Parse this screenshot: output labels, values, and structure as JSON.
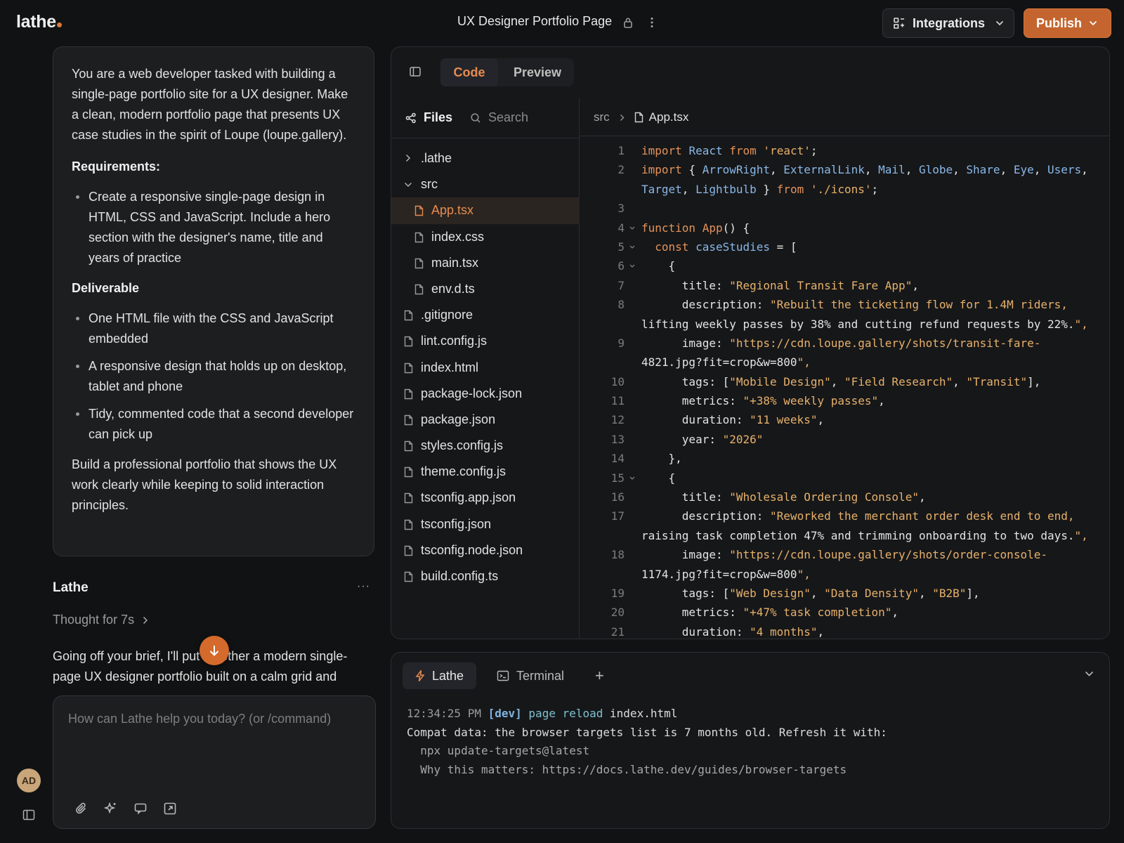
{
  "app": {
    "logo": "lathe"
  },
  "topbar": {
    "doc_title": "UX Designer Portfolio Page",
    "integrations_label": "Integrations",
    "publish_label": "Publish"
  },
  "user": {
    "initials": "AD"
  },
  "prompt": {
    "intro": "You are a web developer tasked with building a single-page portfolio site for a UX designer. Make a clean, modern portfolio page that presents UX case studies in the spirit of Loupe (loupe.gallery).",
    "requirements_heading": "Requirements:",
    "requirements": [
      "Create a responsive single-page design in HTML, CSS and JavaScript. Include a hero section with the designer's name, title and years of practice"
    ],
    "deliverable_heading": "Deliverable",
    "deliverables": [
      "One HTML file with the CSS and JavaScript embedded",
      "A responsive design that holds up on desktop, tablet and phone",
      "Tidy, commented code that a second developer can pick up"
    ],
    "closing": "Build a professional portfolio that shows the UX work clearly while keeping to solid interaction principles."
  },
  "assistant": {
    "name": "Lathe",
    "more": "···",
    "thought": "Thought for 7s",
    "message": "Going off your brief, I'll put together a modern single-page UX designer portfolio built on a calm grid and"
  },
  "composer": {
    "placeholder": "How can Lathe help you today? (or /command)"
  },
  "editor": {
    "tabs": {
      "code": "Code",
      "preview": "Preview"
    },
    "files_label": "Files",
    "search_label": "Search",
    "tree": [
      {
        "label": ".lathe",
        "type": "folder-closed",
        "depth": 0
      },
      {
        "label": "src",
        "type": "folder-open",
        "depth": 0
      },
      {
        "label": "App.tsx",
        "type": "file",
        "depth": 1,
        "active": true
      },
      {
        "label": "index.css",
        "type": "file",
        "depth": 1
      },
      {
        "label": "main.tsx",
        "type": "file",
        "depth": 1
      },
      {
        "label": "env.d.ts",
        "type": "file",
        "depth": 1
      },
      {
        "label": ".gitignore",
        "type": "file",
        "depth": 0
      },
      {
        "label": "lint.config.js",
        "type": "file",
        "depth": 0
      },
      {
        "label": "index.html",
        "type": "file",
        "depth": 0
      },
      {
        "label": "package-lock.json",
        "type": "file",
        "depth": 0
      },
      {
        "label": "package.json",
        "type": "file",
        "depth": 0
      },
      {
        "label": "styles.config.js",
        "type": "file",
        "depth": 0
      },
      {
        "label": "theme.config.js",
        "type": "file",
        "depth": 0
      },
      {
        "label": "tsconfig.app.json",
        "type": "file",
        "depth": 0
      },
      {
        "label": "tsconfig.json",
        "type": "file",
        "depth": 0
      },
      {
        "label": "tsconfig.node.json",
        "type": "file",
        "depth": 0
      },
      {
        "label": "build.config.ts",
        "type": "file",
        "depth": 0
      }
    ],
    "breadcrumb": {
      "folder": "src",
      "file": "App.tsx"
    },
    "code_lines": [
      {
        "n": "1",
        "fold": false,
        "text": "import React from 'react';"
      },
      {
        "n": "2",
        "fold": false,
        "text": "import { ArrowRight, ExternalLink, Mail, Globe, Share, Eye, Users,"
      },
      {
        "n": "",
        "fold": false,
        "text": "Target, Lightbulb } from './icons';"
      },
      {
        "n": "3",
        "fold": false,
        "text": ""
      },
      {
        "n": "4",
        "fold": true,
        "text": "function App() {"
      },
      {
        "n": "5",
        "fold": true,
        "text": "  const caseStudies = ["
      },
      {
        "n": "6",
        "fold": true,
        "text": "    {"
      },
      {
        "n": "7",
        "fold": false,
        "text": "      title: \"Regional Transit Fare App\","
      },
      {
        "n": "8",
        "fold": false,
        "text": "      description: \"Rebuilt the ticketing flow for 1.4M riders,"
      },
      {
        "n": "",
        "fold": false,
        "text": "lifting weekly passes by 38% and cutting refund requests by 22%.\","
      },
      {
        "n": "9",
        "fold": false,
        "text": "      image: \"https://cdn.loupe.gallery/shots/transit-fare-"
      },
      {
        "n": "",
        "fold": false,
        "text": "4821.jpg?fit=crop&w=800\","
      },
      {
        "n": "10",
        "fold": false,
        "text": "      tags: [\"Mobile Design\", \"Field Research\", \"Transit\"],"
      },
      {
        "n": "11",
        "fold": false,
        "text": "      metrics: \"+38% weekly passes\","
      },
      {
        "n": "12",
        "fold": false,
        "text": "      duration: \"11 weeks\","
      },
      {
        "n": "13",
        "fold": false,
        "text": "      year: \"2026\""
      },
      {
        "n": "14",
        "fold": false,
        "text": "    },"
      },
      {
        "n": "15",
        "fold": true,
        "text": "    {"
      },
      {
        "n": "16",
        "fold": false,
        "text": "      title: \"Wholesale Ordering Console\","
      },
      {
        "n": "17",
        "fold": false,
        "text": "      description: \"Reworked the merchant order desk end to end,"
      },
      {
        "n": "",
        "fold": false,
        "text": "raising task completion 47% and trimming onboarding to two days.\","
      },
      {
        "n": "18",
        "fold": false,
        "text": "      image: \"https://cdn.loupe.gallery/shots/order-console-"
      },
      {
        "n": "",
        "fold": false,
        "text": "1174.jpg?fit=crop&w=800\","
      },
      {
        "n": "19",
        "fold": false,
        "text": "      tags: [\"Web Design\", \"Data Density\", \"B2B\"],"
      },
      {
        "n": "20",
        "fold": false,
        "text": "      metrics: \"+47% task completion\","
      },
      {
        "n": "21",
        "fold": false,
        "text": "      duration: \"4 months\","
      }
    ]
  },
  "terminal": {
    "tab_lathe": "Lathe",
    "tab_terminal": "Terminal",
    "add": "+",
    "lines": [
      {
        "time": "12:34:25 PM",
        "tag": "[dev]",
        "action": "page reload",
        "target": "index.html"
      },
      {
        "text": "Compat data: the browser targets list is 7 months old. Refresh it with:"
      },
      {
        "text": "  npx update-targets@latest",
        "dim": true
      },
      {
        "text": "  Why this matters: https://docs.lathe.dev/guides/browser-targets",
        "dim": true
      }
    ]
  },
  "colors": {
    "accent": "#e88b4f",
    "publish": "#c4652f",
    "background": "#111213",
    "panel": "#1d1e20"
  }
}
